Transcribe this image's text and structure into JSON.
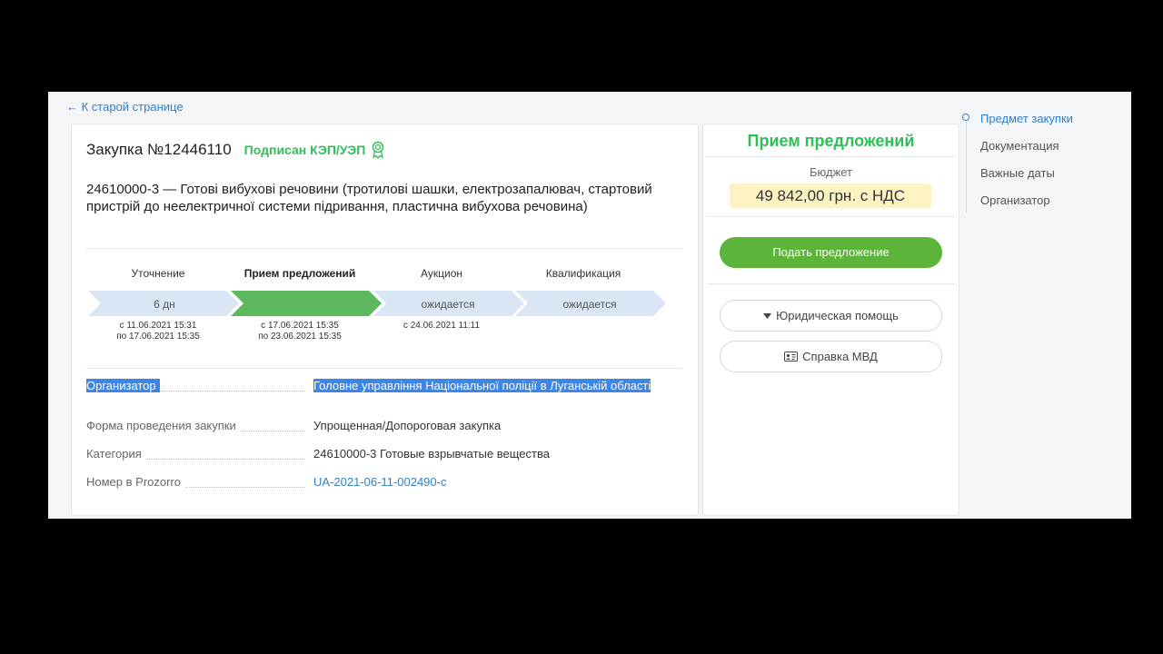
{
  "back_link": "← К старой странице",
  "tender": {
    "title": "Закупка №12446110",
    "signed": "Подписан КЭП/УЭП",
    "subject": "24610000-3 — Готові вибухові речовини (тротилові шашки, електрозапалювач, стартовий пристрій до неелектричної системи підривання, пластична вибухова речовина)"
  },
  "stages": [
    {
      "name": "Уточнение",
      "value": "6 дн",
      "date_line1": "с 11.06.2021 15:31",
      "date_line2": "по 17.06.2021 15:35",
      "active": false
    },
    {
      "name": "Прием предложений",
      "value": "",
      "date_line1": "с 17.06.2021 15:35",
      "date_line2": "по 23.06.2021 15:35",
      "active": true
    },
    {
      "name": "Аукцион",
      "value": "ожидается",
      "date_line1": "с 24.06.2021 11:11",
      "date_line2": "",
      "active": false
    },
    {
      "name": "Квалификация",
      "value": "ожидается",
      "date_line1": "",
      "date_line2": "",
      "active": false
    }
  ],
  "fields": [
    {
      "label": "Организатор",
      "value": "Головне управління Національної поліції в Луганській області"
    },
    {
      "label": "Форма проведения закупки",
      "value": "Упрощенная/Допороговая закупка"
    },
    {
      "label": "Категория",
      "value": "24610000-3 Готовые взрывчатые вещества"
    },
    {
      "label": "Номер в Prozorro",
      "value": "UA-2021-06-11-002490-c"
    }
  ],
  "side": {
    "status": "Прием предложений",
    "budget_label": "Бюджет",
    "budget_value": "49 842,00 грн. с НДС",
    "submit_label": "Подать предложение",
    "legal_help_label": "Юридическая помощь",
    "mvd_label": "Справка МВД"
  },
  "nav": {
    "items": [
      "Предмет закупки",
      "Документация",
      "Важные даты",
      "Организатор"
    ],
    "active_index": 0
  },
  "colors": {
    "accent_green": "#2fbf57",
    "button_green": "#5db43a",
    "link_blue": "#2f80c8",
    "stage_inactive": "#dbe6f5",
    "stage_active": "#5cb85c",
    "selection": "#3b86e6",
    "budget_bg": "#fdf3c2"
  }
}
